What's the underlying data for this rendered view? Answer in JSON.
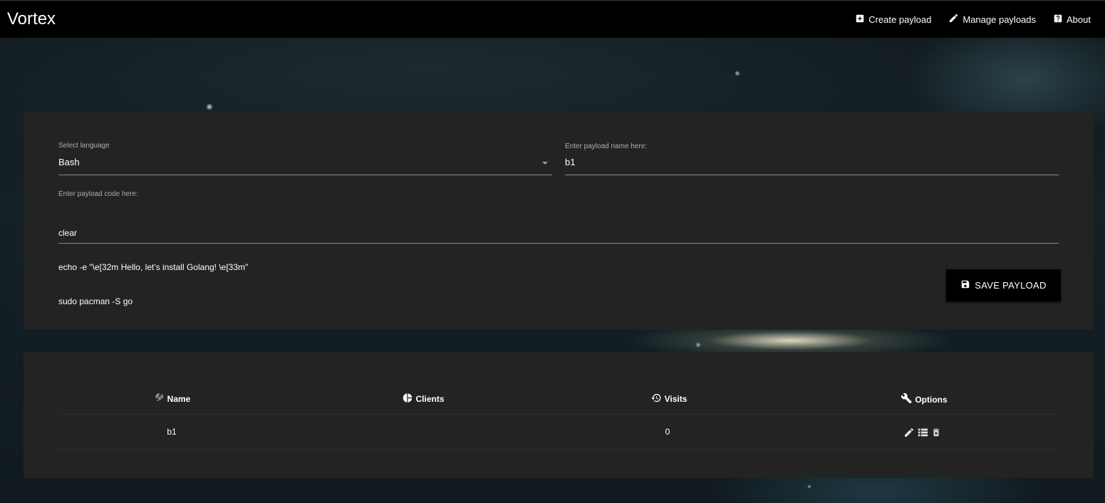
{
  "app": {
    "title": "Vortex"
  },
  "nav": {
    "items": [
      {
        "label": "Create payload",
        "icon": "plus-box-icon"
      },
      {
        "label": "Manage payloads",
        "icon": "pencil-icon"
      },
      {
        "label": "About",
        "icon": "help-box-icon"
      }
    ]
  },
  "form": {
    "language_label": "Select language",
    "language_value": "Bash",
    "name_label": "Enter payload name here:",
    "name_value": "b1",
    "code_label": "Enter payload code here:",
    "code_lines": [
      "clear",
      "echo -e \"\\e[32m Hello, let's install Golang! \\e[33m\"",
      "sudo pacman -S go"
    ],
    "save_label": "SAVE PAYLOAD"
  },
  "table": {
    "columns": [
      {
        "label": "Name",
        "icon": "fingerprint-icon"
      },
      {
        "label": "Clients",
        "icon": "pie-chart-icon"
      },
      {
        "label": "Visits",
        "icon": "history-icon"
      },
      {
        "label": "Options",
        "icon": "wrench-icon"
      }
    ],
    "rows": [
      {
        "name": "b1",
        "clients": "",
        "visits": "0",
        "options": [
          "edit-icon",
          "list-icon",
          "delete-icon"
        ]
      }
    ]
  },
  "colors": {
    "topbar": "#000000",
    "card": "#232323",
    "text": "#ffffff",
    "label": "#aeaeae"
  }
}
